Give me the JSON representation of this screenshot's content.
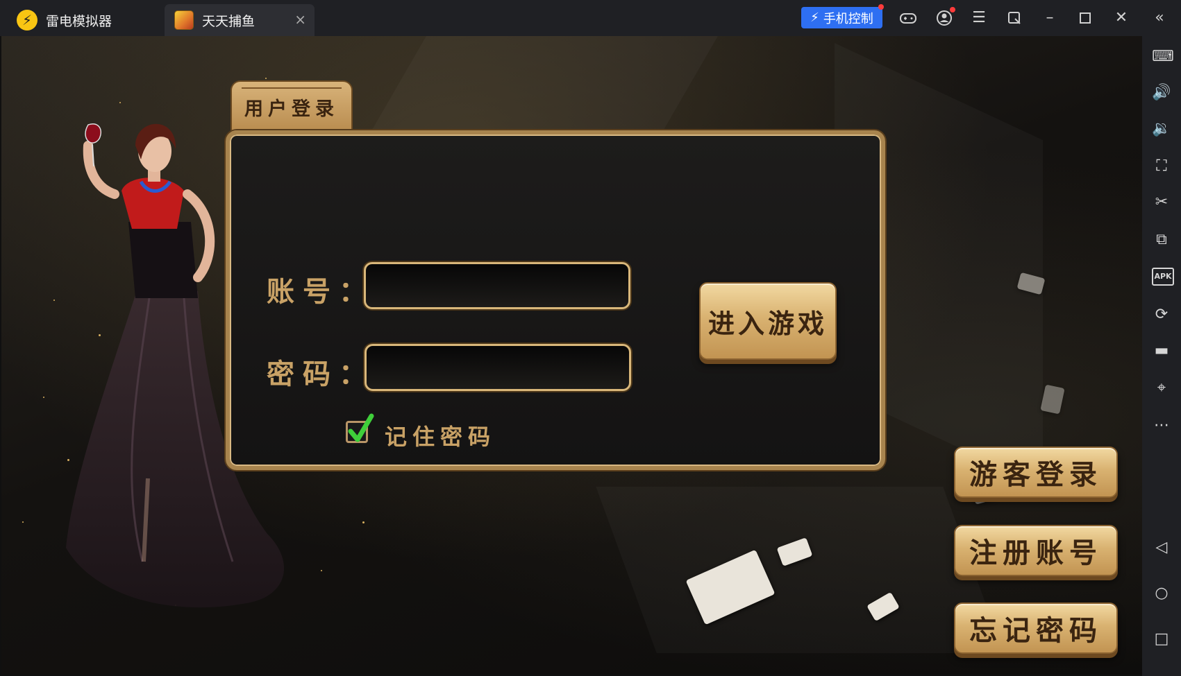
{
  "titlebar": {
    "app_name": "雷电模拟器",
    "tab_title": "天天捕鱼",
    "tab_close": "×",
    "phone_control": "手机控制"
  },
  "icons": {
    "app_logo": "leidian-logo-icon",
    "game_icon": "fishing-game-icon",
    "gamepad": "gamepad-icon",
    "account": "account-icon",
    "menu": "menu-icon",
    "pin_window": "pin-window-icon",
    "minimize": "minimize-icon",
    "maximize": "maximize-icon",
    "close": "close-icon",
    "collapse_sidebar": "double-chevron-left-icon"
  },
  "sidebar": {
    "items": [
      {
        "name": "keyboard-icon",
        "glyph": "⌨"
      },
      {
        "name": "volume-up-icon",
        "glyph": "🔊"
      },
      {
        "name": "volume-down-icon",
        "glyph": "🔉"
      },
      {
        "name": "screenshot-icon",
        "glyph": "⛶"
      },
      {
        "name": "scissors-icon",
        "glyph": "✂"
      },
      {
        "name": "multi-instance-icon",
        "glyph": "⧉"
      },
      {
        "name": "apk-install-icon",
        "glyph": "APK"
      },
      {
        "name": "sync-icon",
        "glyph": "⟳"
      },
      {
        "name": "folder-icon",
        "glyph": "▬"
      },
      {
        "name": "location-icon",
        "glyph": "⌖"
      },
      {
        "name": "more-icon",
        "glyph": "⋯"
      },
      {
        "name": "back-icon",
        "glyph": "◁"
      },
      {
        "name": "home-icon",
        "glyph": "○"
      },
      {
        "name": "recents-icon",
        "glyph": "□"
      }
    ]
  },
  "login": {
    "tab_title": "用户登录",
    "account_label": "账号：",
    "password_label": "密码：",
    "account_value": "",
    "password_value": "",
    "remember_label": "记住密码",
    "remember_checked": true,
    "enter_button": "进入游戏"
  },
  "side_buttons": {
    "guest_login": "游客登录",
    "register": "注册账号",
    "forgot_password": "忘记密码"
  },
  "colors": {
    "accent_blue": "#2e6ff2",
    "gold": "#c9a266",
    "checkbox_green": "#3fcf3a"
  }
}
